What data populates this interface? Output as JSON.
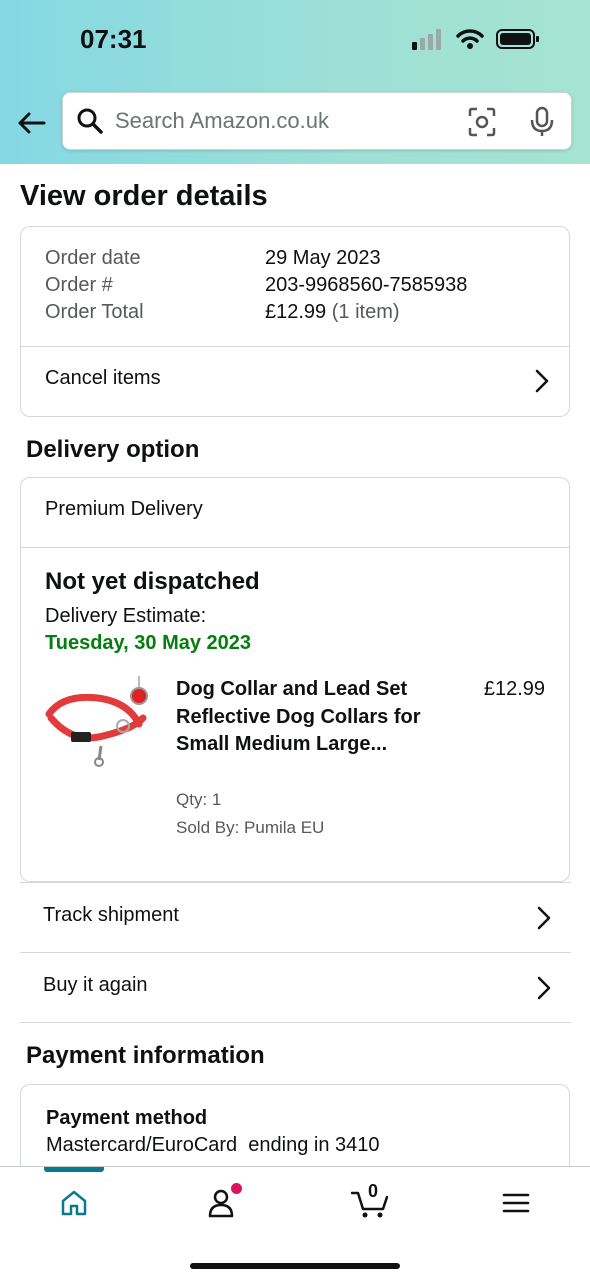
{
  "status_bar": {
    "time": "07:31"
  },
  "search": {
    "placeholder": "Search Amazon.co.uk"
  },
  "page": {
    "title": "View order details"
  },
  "order_summary": {
    "rows": [
      {
        "label": "Order date",
        "value": "29 May 2023"
      },
      {
        "label": "Order #",
        "value": "203-9968560-7585938"
      },
      {
        "label": "Order Total",
        "value": "£12.99",
        "suffix": "(1 item)"
      }
    ],
    "cancel_label": "Cancel items"
  },
  "delivery": {
    "section_title": "Delivery option",
    "option": "Premium Delivery",
    "status": "Not yet dispatched",
    "estimate_label": "Delivery Estimate:",
    "estimate_date": "Tuesday, 30 May 2023",
    "estimate_color": "#067d0f",
    "item": {
      "title": "Dog Collar and Lead Set Reflective Dog Collars for Small Medium Large...",
      "price": "£12.99",
      "qty": "Qty: 1",
      "seller": "Sold By: Pumila EU"
    }
  },
  "actions": {
    "track": "Track shipment",
    "buy_again": "Buy it again"
  },
  "payment": {
    "section_title": "Payment information",
    "method_title": "Payment method",
    "method_value": "Mastercard/EuroCard  ending in 3410"
  },
  "bottom_nav": {
    "items": [
      "home-icon",
      "account-icon",
      "cart-icon",
      "menu-icon"
    ],
    "cart_count": "0",
    "active_color": "#0a7b8f",
    "notification_color": "#e0115f"
  }
}
